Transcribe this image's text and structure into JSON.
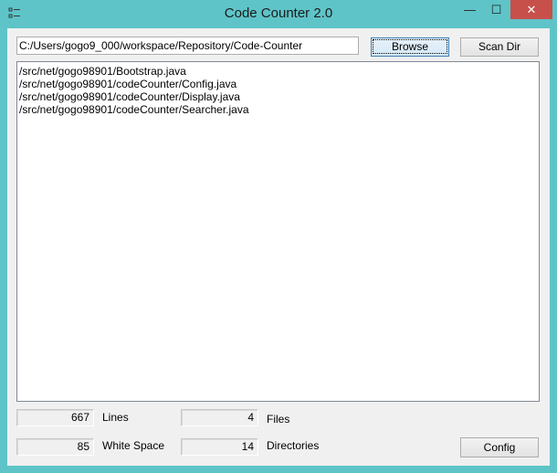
{
  "window": {
    "title": "Code Counter 2.0",
    "min_glyph": "—",
    "max_glyph": "☐",
    "close_glyph": "✕"
  },
  "path": {
    "value": "C:/Users/gogo9_000/workspace/Repository/Code-Counter"
  },
  "buttons": {
    "browse": "Browse",
    "scan": "Scan Dir",
    "config": "Config"
  },
  "files": [
    "/src/net/gogo98901/Bootstrap.java",
    "/src/net/gogo98901/codeCounter/Config.java",
    "/src/net/gogo98901/codeCounter/Display.java",
    "/src/net/gogo98901/codeCounter/Searcher.java"
  ],
  "stats": {
    "lines_value": "667",
    "lines_label": "Lines",
    "whitespace_value": "85",
    "whitespace_label": "White Space",
    "files_value": "4",
    "files_label": "Files",
    "dirs_value": "14",
    "dirs_label": "Directories"
  },
  "colors": {
    "titlebar": "#5ec4c8",
    "close": "#c7504b",
    "focus_border": "#3c7fb1"
  }
}
